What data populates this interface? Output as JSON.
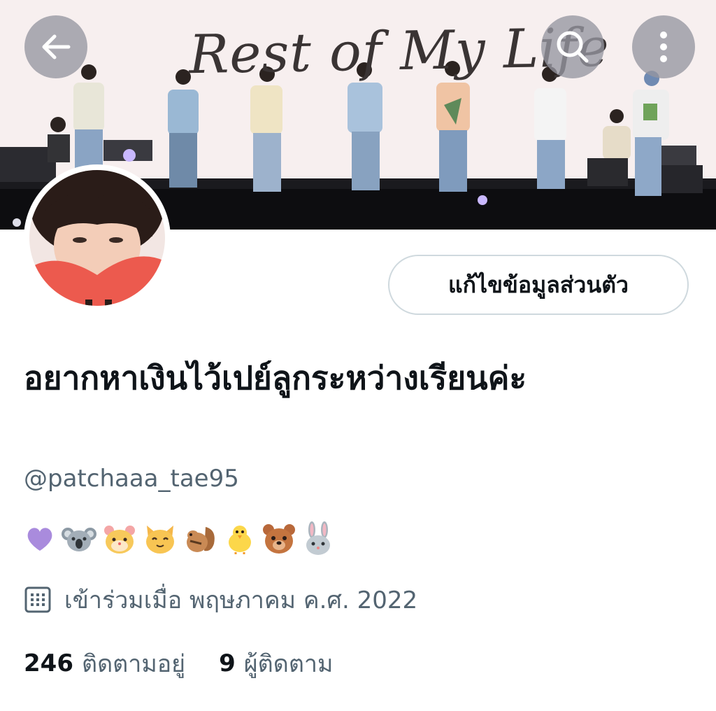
{
  "header": {
    "banner_text": "Rest of My Life",
    "back_icon": "arrow-left-icon",
    "search_icon": "search-icon",
    "more_icon": "more-vertical-icon"
  },
  "profile": {
    "edit_button_label": "แก้ไขข้อมูลส่วนตัว",
    "display_name": "อยากหาเงินไว้เปย์ลูกระหว่างเรียนค่ะ",
    "handle": "@patchaaa_tae95",
    "bio_emojis": [
      "purple-heart",
      "koala",
      "hamster",
      "cat",
      "chipmunk",
      "chick",
      "bear",
      "rabbit"
    ],
    "joined": "เข้าร่วมเมื่อ พฤษภาคม ค.ศ. 2022",
    "joined_icon": "calendar-icon"
  },
  "stats": {
    "following_count": "246",
    "following_label": "ติดตามอยู่",
    "followers_count": "9",
    "followers_label": "ผู้ติดตาม"
  },
  "colors": {
    "text_primary": "#0f1419",
    "text_secondary": "#536471",
    "border": "#cfd9de",
    "overlay_button": "#9696a0"
  }
}
